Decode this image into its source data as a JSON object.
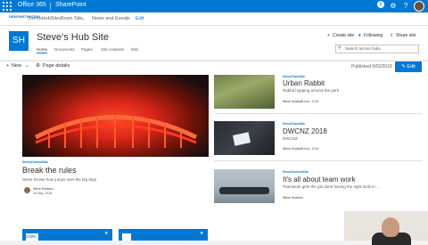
{
  "suite": {
    "title": "Office 365",
    "app": "SharePoint",
    "notif_count": "1"
  },
  "hub_nav": {
    "logo": "DEMONSTRATION",
    "name": "DemoHubSites",
    "items": [
      "Team Site",
      "News and Events",
      "Edit"
    ]
  },
  "site": {
    "logo": "SH",
    "title": "Steve's Hub Site",
    "tabs": [
      "Home",
      "Documents",
      "Pages",
      "Site contents",
      "Edit"
    ],
    "actions": {
      "create_site": "Create site",
      "following": "Following",
      "share_site": "Share site"
    },
    "search_placeholder": "Search across hubs"
  },
  "command_bar": {
    "new": "New",
    "page_details": "Page details",
    "published": "Published 6/02/2018",
    "edit": "Edit"
  },
  "news_main": {
    "site": "DemoCommsSite",
    "title": "Break the rules",
    "desc": "Steve knows how jumps over the big dog!",
    "author": "Steve Knutson",
    "date": "18 May, 2018"
  },
  "news_items": [
    {
      "site": "DemoTeamSite",
      "title": "Urban Rabbit",
      "desc": "Rabbit hopping around the park",
      "author": "Steve Knutson",
      "date": "7 June, 2018"
    },
    {
      "site": "DemoTeamSite",
      "title": "DWCNZ 2018",
      "desc": "DWCNZ",
      "author": "Steve Knutson",
      "date": "7 June, 2018"
    },
    {
      "site": "DemoCommsSite",
      "title": "It's all about team work",
      "desc": "Teamwork gets the job done having the right tools in ...",
      "author": "Steve Knutson",
      "date": ""
    }
  ],
  "tile_text": "crate",
  "colors": {
    "accent": "#0078d4",
    "hero_red": "#e0301e"
  }
}
